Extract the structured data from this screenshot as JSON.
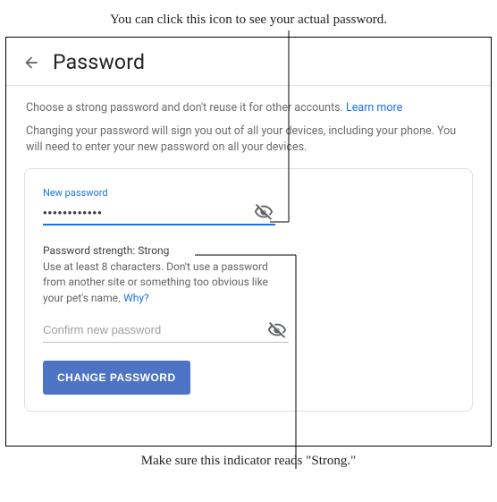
{
  "annotations": {
    "top": "You can click this icon to see your actual password.",
    "bottom": "Make sure this indicator reads \"Strong.\""
  },
  "header": {
    "title": "Password"
  },
  "info": {
    "line1_prefix": "Choose a strong password and don't reuse it for other accounts. ",
    "learn_more": "Learn more",
    "line2": "Changing your password will sign you out of all your devices, including your phone. You will need to enter your new password on all your devices."
  },
  "form": {
    "new_password_label": "New password",
    "new_password_value": "••••••••••••",
    "strength_label": "Password strength: ",
    "strength_value": "Strong",
    "strength_hint_prefix": "Use at least 8 characters. Don't use a password from another site or something too obvious like your pet's name. ",
    "why_link": "Why?",
    "confirm_placeholder": "Confirm new password",
    "button_label": "CHANGE PASSWORD"
  }
}
